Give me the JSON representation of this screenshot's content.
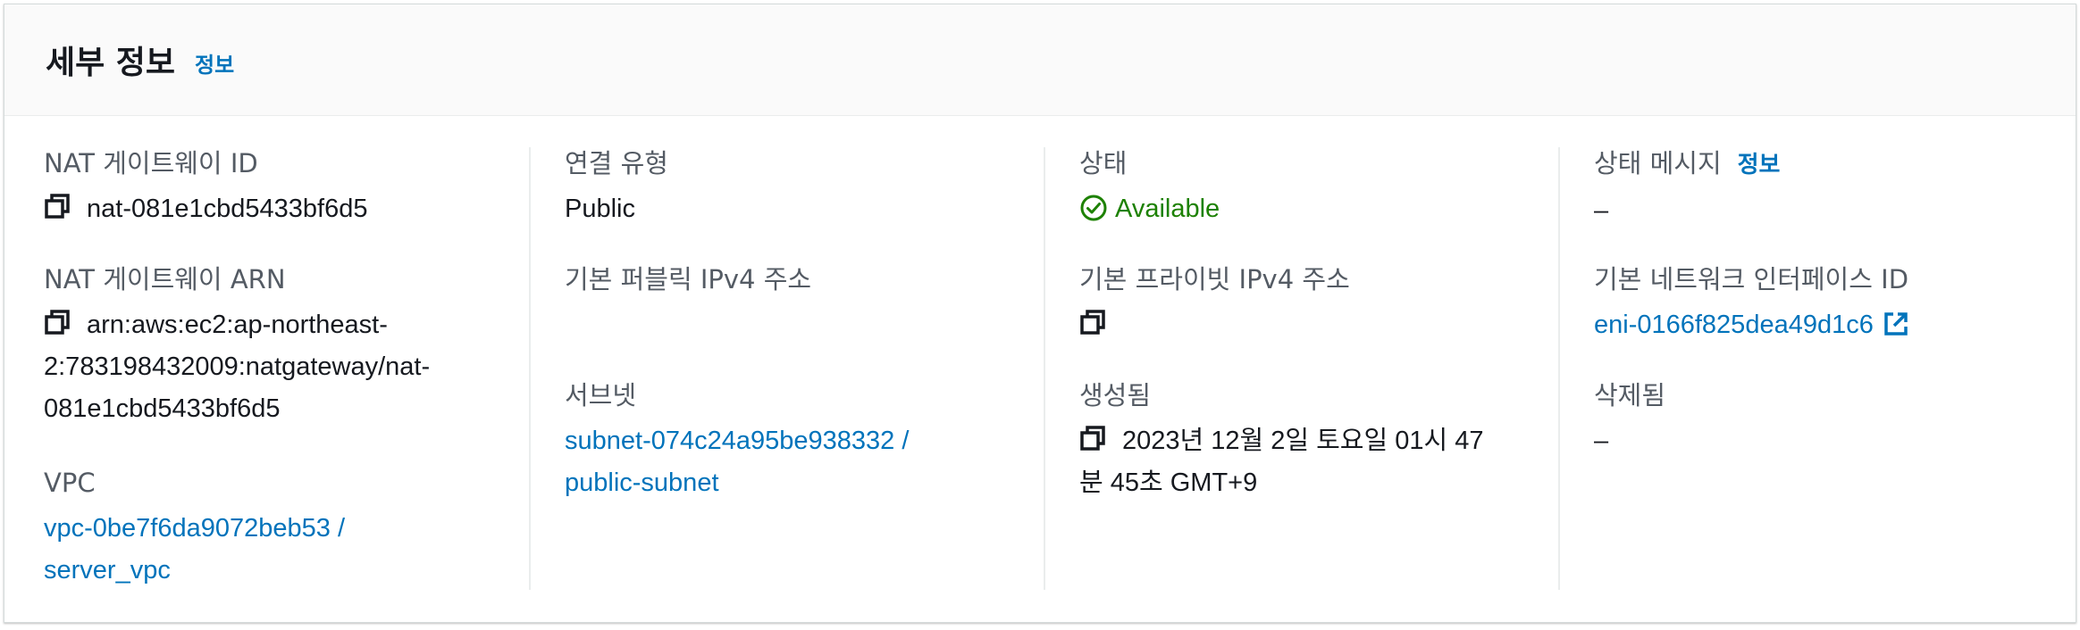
{
  "header": {
    "title": "세부 정보",
    "info_link": "정보"
  },
  "columns": {
    "col1": {
      "nat_id": {
        "label": "NAT 게이트웨이 ID",
        "value": "nat-081e1cbd5433bf6d5",
        "icon": "copy-icon"
      },
      "nat_arn": {
        "label": "NAT 게이트웨이 ARN",
        "lines": [
          "arn:aws:ec2:ap-northeast-",
          "2:783198432009:natgateway/nat-",
          "081e1cbd5433bf6d5"
        ],
        "icon": "copy-icon"
      },
      "vpc": {
        "label": "VPC",
        "lines": [
          "vpc-0be7f6da9072beb53 /",
          "server_vpc"
        ]
      }
    },
    "col2": {
      "connectivity": {
        "label": "연결 유형",
        "value": "Public"
      },
      "public_ip": {
        "label": "기본 퍼블릭 IPv4 주소",
        "value": ""
      },
      "subnet": {
        "label": "서브넷",
        "lines": [
          "subnet-074c24a95be938332 /",
          "public-subnet"
        ]
      }
    },
    "col3": {
      "state": {
        "label": "상태",
        "value": "Available",
        "icon": "check-circle-icon",
        "color": "#1d8102"
      },
      "private_ip": {
        "label": "기본 프라이빗 IPv4 주소",
        "value": "",
        "icon": "copy-icon"
      },
      "created": {
        "label": "생성됨",
        "lines": [
          "2023년 12월 2일 토요일 01시 47",
          "분 45초 GMT+9"
        ],
        "icon": "copy-icon"
      }
    },
    "col4": {
      "state_message": {
        "label": "상태 메시지",
        "info_link": "정보",
        "value": "–"
      },
      "eni": {
        "label": "기본 네트워크 인터페이스 ID",
        "value": "eni-0166f825dea49d1c6",
        "icon": "external-link-icon"
      },
      "deleted": {
        "label": "삭제됨",
        "value": "–"
      }
    }
  },
  "colors": {
    "link": "#0073bb",
    "success": "#1d8102",
    "label": "#545b64"
  }
}
